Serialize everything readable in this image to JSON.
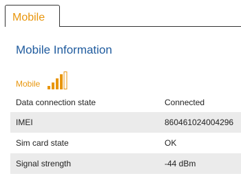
{
  "tab": {
    "label": "Mobile"
  },
  "page_title": "Mobile Information",
  "section": {
    "label": "Mobile",
    "signal_icon": "signal-bars-icon",
    "signal_level": 1.0
  },
  "rows": [
    {
      "key": "Data connection state",
      "value": "Connected"
    },
    {
      "key": "IMEI",
      "value": "860461024004296"
    },
    {
      "key": "Sim card state",
      "value": "OK"
    },
    {
      "key": "Signal strength",
      "value": "-44 dBm"
    }
  ],
  "colors": {
    "accent_orange": "#e8960e",
    "title_blue": "#1f5b9e",
    "row_shade": "#ebebeb",
    "border": "#333333"
  }
}
